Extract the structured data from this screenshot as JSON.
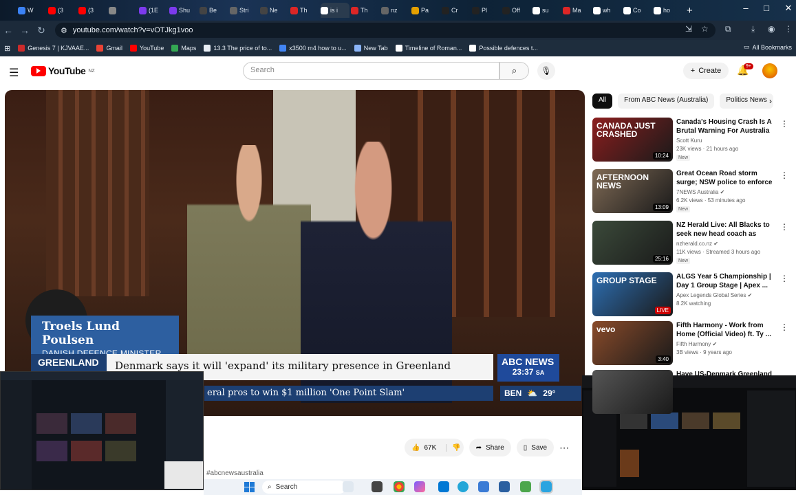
{
  "browser": {
    "tabs": [
      {
        "label": "W",
        "color": "#3b82f6"
      },
      {
        "label": "(3",
        "color": "#ff0000"
      },
      {
        "label": "(3",
        "color": "#ff0000"
      },
      {
        "label": "",
        "color": "#888888"
      },
      {
        "label": "(1E",
        "color": "#7c3aed"
      },
      {
        "label": "Shu",
        "color": "#7c3aed"
      },
      {
        "label": "Be",
        "color": "#444444"
      },
      {
        "label": "Stri",
        "color": "#666666"
      },
      {
        "label": "Ne",
        "color": "#444444"
      },
      {
        "label": "Th",
        "color": "#dc2626"
      },
      {
        "label": "is i",
        "color": "#ffffff"
      },
      {
        "label": "Th",
        "color": "#dc2626"
      },
      {
        "label": "nz",
        "color": "#666666"
      },
      {
        "label": "Pa",
        "color": "#e5a000"
      },
      {
        "label": "Cr",
        "color": "#222222"
      },
      {
        "label": "Pl",
        "color": "#222222"
      },
      {
        "label": "Off",
        "color": "#222222"
      },
      {
        "label": "su",
        "color": "#ffffff"
      },
      {
        "label": "Ma",
        "color": "#dc2626"
      },
      {
        "label": "wh",
        "color": "#ffffff"
      },
      {
        "label": "Co",
        "color": "#ffffff"
      },
      {
        "label": "ho",
        "color": "#ffffff"
      }
    ],
    "url": "youtube.com/watch?v=vOTJkg1voo",
    "bookmarks": [
      {
        "label": "Genesis 7 | KJVAAE...",
        "color": "#cc2b2b"
      },
      {
        "label": "Gmail",
        "color": "#ea4335"
      },
      {
        "label": "YouTube",
        "color": "#ff0000"
      },
      {
        "label": "Maps",
        "color": "#34a853"
      },
      {
        "label": "13.3 The price of to...",
        "color": "#e8eef5"
      },
      {
        "label": "x3500 m4 how to u...",
        "color": "#4285f4"
      },
      {
        "label": "New Tab",
        "color": "#8ab4f8"
      },
      {
        "label": "Timeline of Roman...",
        "color": "#ffffff"
      },
      {
        "label": "Possible defences t...",
        "color": "#ffffff"
      }
    ],
    "all_bookmarks": "All Bookmarks"
  },
  "youtube": {
    "logo_text": "YouTube",
    "region": "NZ",
    "search_placeholder": "Search",
    "create_label": "Create",
    "notif_count": "9+"
  },
  "video": {
    "name_line": "Troels Lund Poulsen",
    "role_line": "DANISH DEFENCE MINISTER",
    "tag": "GREENLAND",
    "headline": "Denmark says it will 'expand' its military presence in Greenland",
    "channel_logo": "ABC NEWS",
    "time": "23:37",
    "time_zone": "SA",
    "ticker": "eral pros to win $1 million 'One Point Slam'",
    "weather_city": "BEN",
    "weather_temp": "29°"
  },
  "actions": {
    "likes": "67K",
    "share": "Share",
    "save": "Save"
  },
  "hashtag": "#abcnewsaustralia",
  "chips": [
    "All",
    "From ABC News (Australia)",
    "Politics News"
  ],
  "related": [
    {
      "title": "Canada's Housing Crash Is A Brutal Warning For Australia ...",
      "channel": "Scott Kuru",
      "meta": "23K views · 21 hours ago",
      "badge": "New",
      "duration": "10:24",
      "thumb_text": "CANADA JUST CRASHED",
      "thumb_color": "#8b1e1e",
      "verified": false
    },
    {
      "title": "Great Ocean Road storm surge; NSW police to enforce protest ...",
      "channel": "7NEWS Australia",
      "meta": "6.2K views · 53 minutes ago",
      "badge": "New",
      "duration": "13:09",
      "thumb_text": "AFTERNOON NEWS",
      "thumb_color": "#7f6a55",
      "verified": true
    },
    {
      "title": "NZ Herald Live: All Blacks to seek new head coach as Scott...",
      "channel": "nzherald.co.nz",
      "meta": "11K views · Streamed 3 hours ago",
      "badge": "New",
      "duration": "25:16",
      "thumb_text": "",
      "thumb_color": "#3b4a3a",
      "verified": true
    },
    {
      "title": "ALGS Year 5 Championship | Day 1 Group Stage | Apex ...",
      "channel": "Apex Legends Global Series",
      "meta": "8.2K watching",
      "badge": "",
      "duration": "LIVE",
      "thumb_text": "GROUP STAGE",
      "thumb_color": "#2d6fb3",
      "verified": true
    },
    {
      "title": "Fifth Harmony - Work from Home (Official Video) ft. Ty ...",
      "channel": "Fifth Harmony",
      "meta": "3B views · 9 years ago",
      "badge": "",
      "duration": "3:40",
      "thumb_text": "vevo",
      "thumb_color": "#8a4b2a",
      "verified": true
    },
    {
      "title": "Have US-Denmark Greenland",
      "channel": "",
      "meta": "",
      "badge": "",
      "duration": "",
      "thumb_text": "",
      "thumb_color": "#555555",
      "verified": false
    }
  ],
  "taskbar": {
    "search_label": "Search"
  }
}
